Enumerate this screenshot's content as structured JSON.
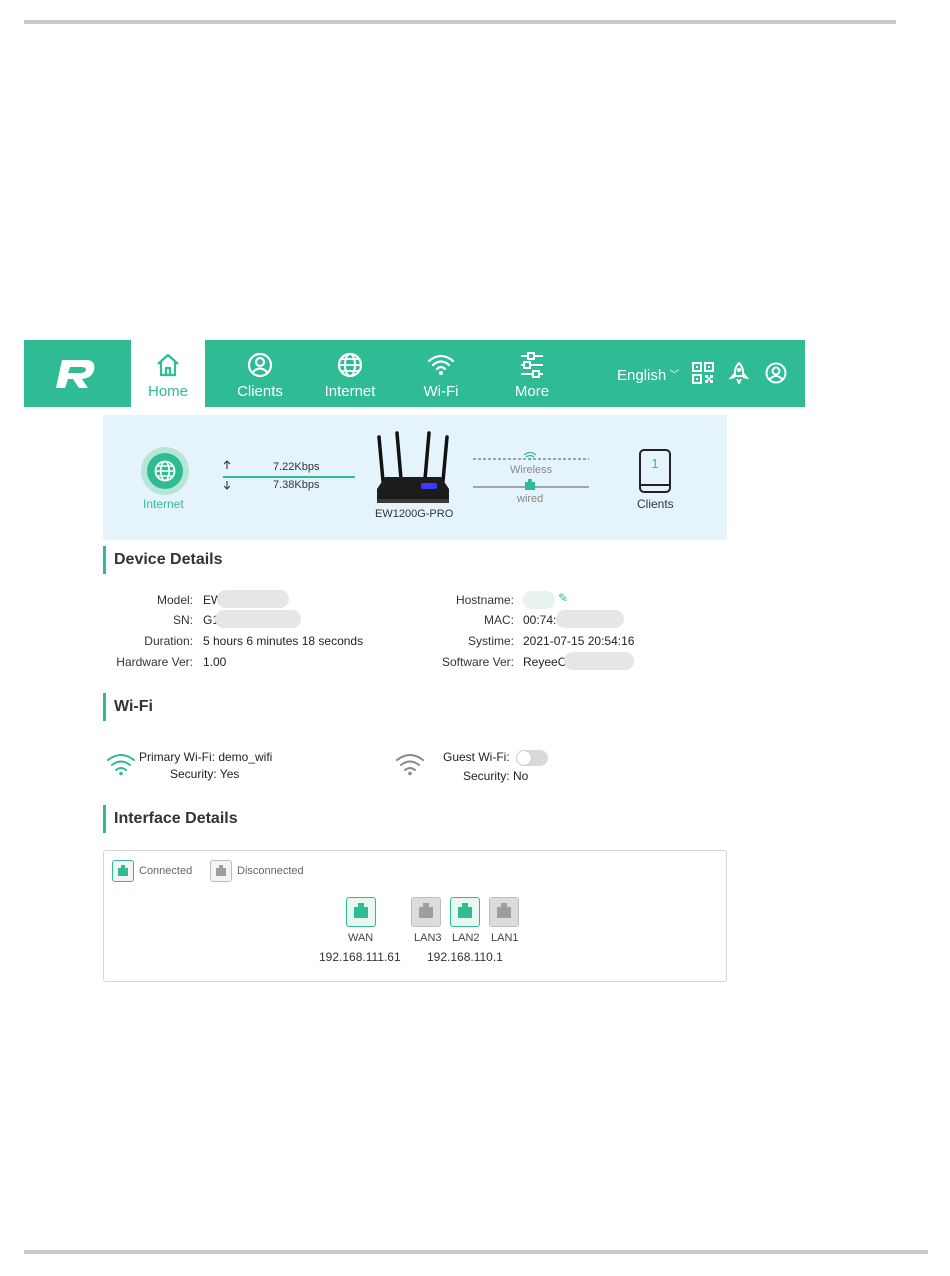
{
  "nav": {
    "items": [
      {
        "label": "Home",
        "icon": "home-icon",
        "active": true
      },
      {
        "label": "Clients",
        "icon": "user-icon"
      },
      {
        "label": "Internet",
        "icon": "globe-icon"
      },
      {
        "label": "Wi-Fi",
        "icon": "wifi-icon"
      },
      {
        "label": "More",
        "icon": "sliders-icon"
      }
    ],
    "language": "English"
  },
  "topology": {
    "internet_label": "Internet",
    "upload": "7.22Kbps",
    "download": "7.38Kbps",
    "device_name": "EW1200G-PRO",
    "wireless_label": "Wireless",
    "wired_label": "wired",
    "clients_label": "Clients",
    "clients_count": "1"
  },
  "device_details": {
    "title": "Device Details",
    "left": [
      {
        "key": "Model:",
        "value": "EW"
      },
      {
        "key": "SN:",
        "value": "G1"
      },
      {
        "key": "Duration:",
        "value": "5 hours 6 minutes 18 seconds"
      },
      {
        "key": "Hardware Ver:",
        "value": "1.00"
      }
    ],
    "right": [
      {
        "key": "Hostname:",
        "value": ""
      },
      {
        "key": "MAC:",
        "value": "00:74:"
      },
      {
        "key": "Systime:",
        "value": "2021-07-15 20:54:16"
      },
      {
        "key": "Software Ver:",
        "value": "ReyeeO"
      }
    ]
  },
  "wifi": {
    "title": "Wi-Fi",
    "primary": {
      "label": "Primary Wi-Fi: demo_wifi",
      "security": "Security: Yes"
    },
    "guest": {
      "label": "Guest Wi-Fi:",
      "security": "Security: No"
    }
  },
  "interface": {
    "title": "Interface Details",
    "legend_connected": "Connected",
    "legend_disconnected": "Disconnected",
    "ports": [
      {
        "name": "WAN",
        "connected": true
      },
      {
        "name": "LAN3",
        "connected": false
      },
      {
        "name": "LAN2",
        "connected": true
      },
      {
        "name": "LAN1",
        "connected": false
      }
    ],
    "wan_ip": "192.168.111.61",
    "lan_ip": "192.168.110.1"
  },
  "colors": {
    "accent": "#2fbb94",
    "topology_bg": "#e5f4fc"
  }
}
